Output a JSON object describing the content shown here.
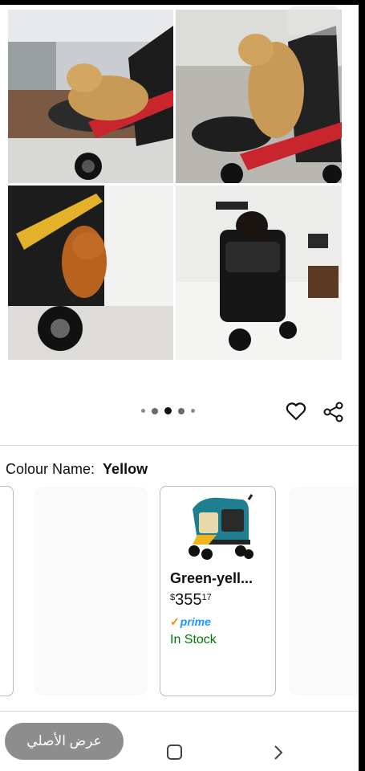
{
  "gallery": {
    "images": [
      {
        "icon": "dog-photo-1"
      },
      {
        "icon": "dog-photo-2"
      },
      {
        "icon": "dog-photo-3"
      },
      {
        "icon": "dog-photo-4"
      }
    ],
    "dots_count": 5,
    "active_dot": 2
  },
  "actions": {
    "wishlist_icon": "heart-icon",
    "share_icon": "share-icon"
  },
  "variation": {
    "label": "Colour Name:",
    "value": "Yellow"
  },
  "swatch": {
    "name": "Green-yell...",
    "price_symbol": "$",
    "price_whole": "355",
    "price_fraction": "17",
    "prime_check": "✓",
    "prime_label": "prime",
    "availability": "In Stock"
  },
  "bottom_bar": {
    "original_button": "عرض الأصلي",
    "home_icon": "square-icon",
    "forward_icon": "chevron-right-icon"
  },
  "colors": {
    "prime": "#1a98ff",
    "in_stock": "#007600",
    "pill": "#8d8d8d"
  }
}
